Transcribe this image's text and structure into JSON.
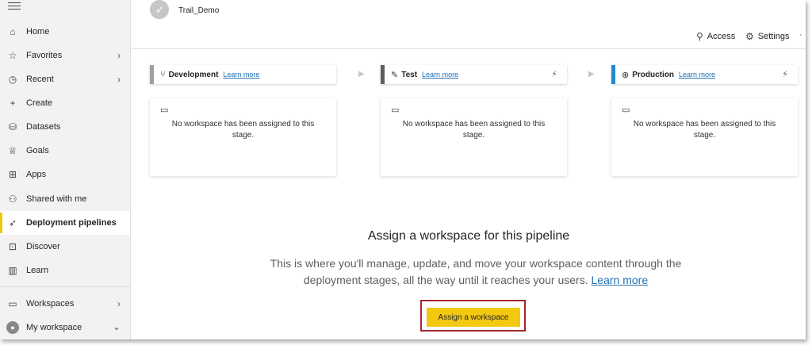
{
  "sidebar": {
    "items": [
      {
        "label": "Home",
        "icon": "home-icon",
        "glyph": "⌂"
      },
      {
        "label": "Favorites",
        "icon": "star-icon",
        "glyph": "☆"
      },
      {
        "label": "Recent",
        "icon": "clock-icon",
        "glyph": "◷"
      },
      {
        "label": "Create",
        "icon": "plus-icon",
        "glyph": "+"
      },
      {
        "label": "Datasets",
        "icon": "database-icon",
        "glyph": "⛁"
      },
      {
        "label": "Goals",
        "icon": "trophy-icon",
        "glyph": "♕"
      },
      {
        "label": "Apps",
        "icon": "apps-icon",
        "glyph": "⊞"
      },
      {
        "label": "Shared with me",
        "icon": "shared-icon",
        "glyph": "⚇"
      },
      {
        "label": "Deployment pipelines",
        "icon": "rocket-icon",
        "glyph": "🚀"
      },
      {
        "label": "Discover",
        "icon": "discover-icon",
        "glyph": "⊡"
      },
      {
        "label": "Learn",
        "icon": "book-icon",
        "glyph": "▥"
      },
      {
        "label": "Workspaces",
        "icon": "workspaces-icon",
        "glyph": "▭"
      },
      {
        "label": "My workspace",
        "icon": "avatar",
        "glyph": ""
      }
    ]
  },
  "header": {
    "pipeline_name": "Trail_Demo",
    "access_label": "Access",
    "settings_label": "Settings",
    "more": "·"
  },
  "stages": [
    {
      "name": "Development",
      "learn_more": "Learn more",
      "color": "#a19f9d",
      "icon_glyph": "⑂"
    },
    {
      "name": "Test",
      "learn_more": "Learn more",
      "color": "#605e5c",
      "icon_glyph": "✎"
    },
    {
      "name": "Production",
      "learn_more": "Learn more",
      "color": "#1f8ad2",
      "icon_glyph": "⊕"
    }
  ],
  "stage_empty_text": "No workspace has been assigned to this stage.",
  "assign": {
    "title": "Assign a workspace for this pipeline",
    "description": "This is where you'll manage, update, and move your workspace content through the deployment stages, all the way until it reaches your users.",
    "learn_more": "Learn more",
    "button_label": "Assign a workspace"
  },
  "colors": {
    "accent_yellow": "#f2c811",
    "highlight_red": "#a4262c",
    "link_blue": "#1f6fb3"
  }
}
